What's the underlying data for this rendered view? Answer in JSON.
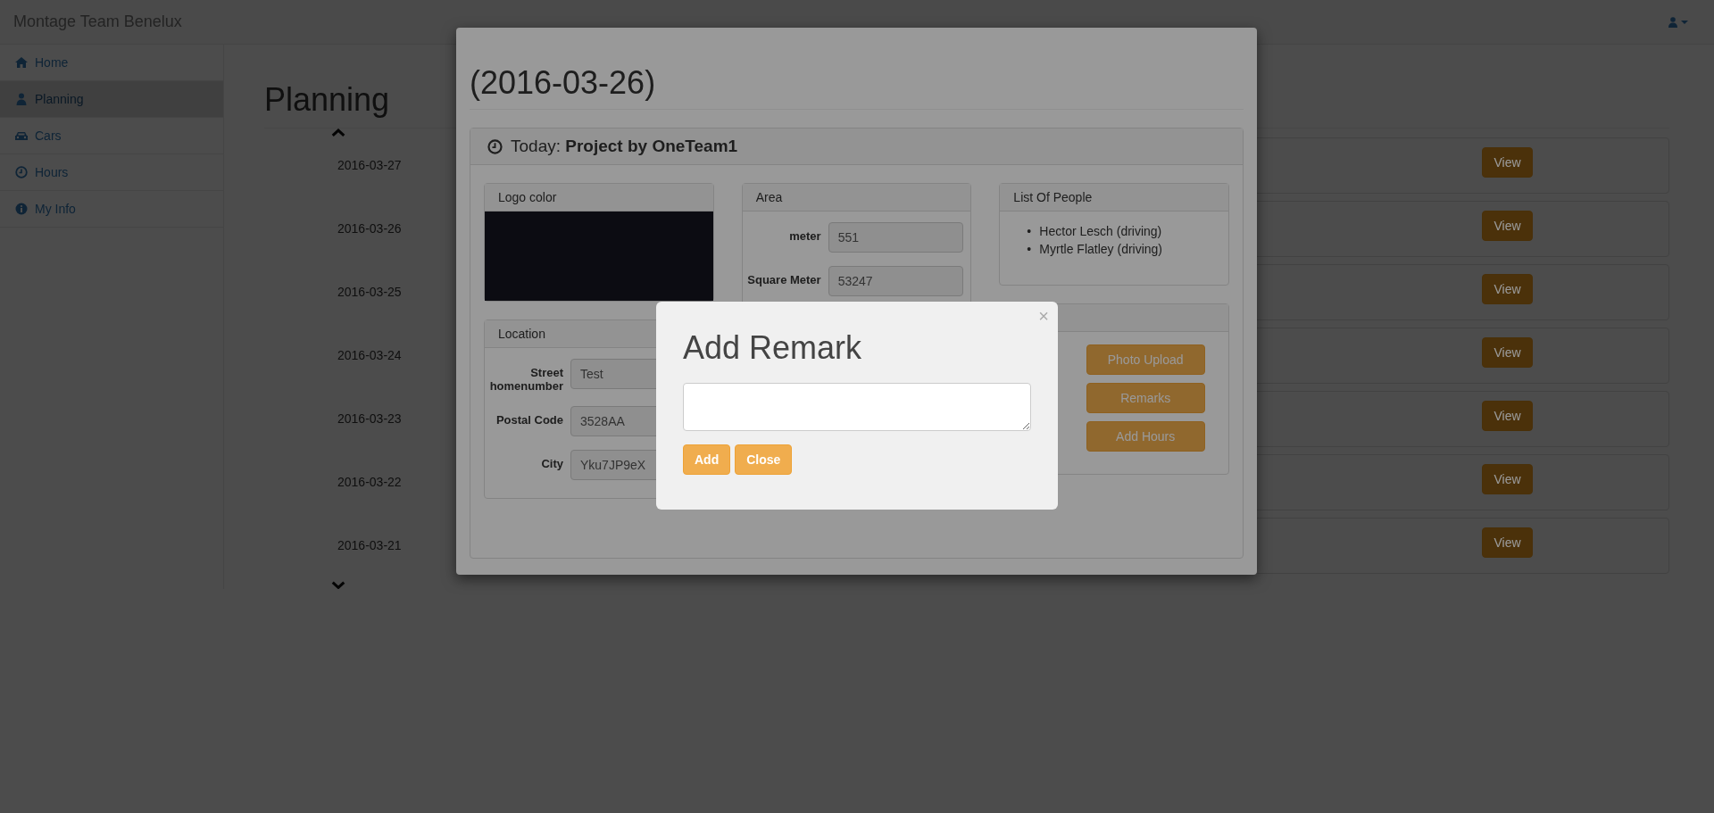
{
  "navbar": {
    "brand": "Montage Team Benelux"
  },
  "sidebar": {
    "items": [
      {
        "label": "Home",
        "kind": "home",
        "selected": false
      },
      {
        "label": "Planning",
        "kind": "user",
        "selected": true
      },
      {
        "label": "Cars",
        "kind": "car",
        "selected": false
      },
      {
        "label": "Hours",
        "kind": "clock",
        "selected": false
      },
      {
        "label": "My Info",
        "kind": "info",
        "selected": false
      }
    ]
  },
  "page": {
    "title": "Planning",
    "days": [
      {
        "date": "2016-03-27",
        "button": "View"
      },
      {
        "date": "2016-03-26",
        "button": "View"
      },
      {
        "date": "2016-03-25",
        "button": "View"
      },
      {
        "date": "2016-03-24",
        "button": "View"
      },
      {
        "date": "2016-03-23",
        "button": "View"
      },
      {
        "date": "2016-03-22",
        "button": "View"
      },
      {
        "date": "2016-03-21",
        "button": "View"
      }
    ]
  },
  "modal": {
    "title": "(2016-03-26)",
    "panel_title": "Today: **Project by OneTeam1**",
    "logo": {
      "title": "Logo color"
    },
    "location": {
      "title": "Location",
      "fields": [
        {
          "label": "Street homenumber",
          "value": "Test"
        },
        {
          "label": "Postal Code",
          "value": "3528AA"
        },
        {
          "label": "City",
          "value": "Yku7JP9eX"
        }
      ]
    },
    "area": {
      "title": "Area",
      "fields": [
        {
          "label": "meter",
          "value": "551"
        },
        {
          "label": "Square Meter",
          "value": "53247"
        }
      ]
    },
    "people": {
      "title": "List Of People",
      "items": [
        {
          "bullet": "•",
          "name": "Hector Lesch (driving)"
        },
        {
          "bullet": "•",
          "name": "Myrtle Flatley (driving)"
        }
      ]
    },
    "actions": {
      "buttons": [
        "Photo Upload",
        "Remarks",
        "Add Hours"
      ]
    }
  },
  "dialog": {
    "title": "Add Remark",
    "close": "×",
    "buttons": [
      "Add",
      "Close"
    ]
  }
}
